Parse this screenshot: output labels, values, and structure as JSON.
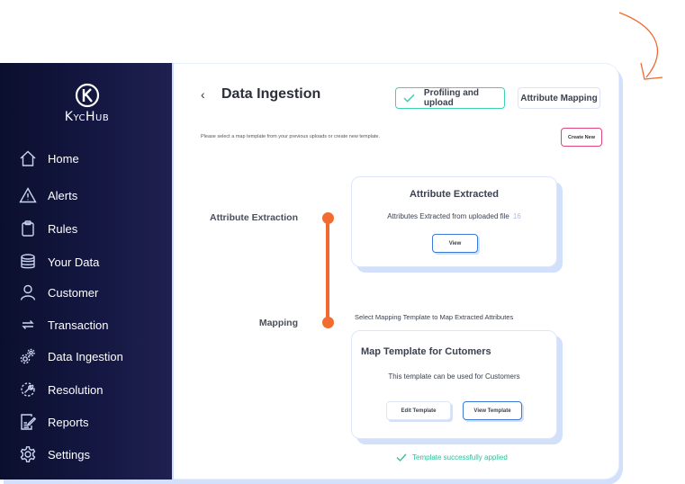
{
  "brand": {
    "name": "KycHub",
    "logo_icon": "k-circle-logo-icon"
  },
  "sidebar": {
    "items": [
      {
        "label": "Home",
        "icon": "home-icon"
      },
      {
        "label": "Alerts",
        "icon": "alert-triangle-icon"
      },
      {
        "label": "Rules",
        "icon": "clipboard-icon"
      },
      {
        "label": "Your Data",
        "icon": "database-icon"
      },
      {
        "label": "Customer",
        "icon": "user-icon"
      },
      {
        "label": "Transaction",
        "icon": "transfer-arrows-icon"
      },
      {
        "label": "Data Ingestion",
        "icon": "gears-icon"
      },
      {
        "label": "Resolution",
        "icon": "gear-wrench-icon"
      },
      {
        "label": "Reports",
        "icon": "report-edit-icon"
      },
      {
        "label": "Settings",
        "icon": "settings-gear-icon"
      }
    ]
  },
  "header": {
    "back_label": "‹",
    "title": "Data Ingestion",
    "steps": [
      {
        "label": "Profiling and upload",
        "status": "completed"
      },
      {
        "label": "Attribute Mapping",
        "status": "pending"
      }
    ]
  },
  "helper_text": "Please select a map template from your previous uploads or create new template.",
  "create_new_label": "Create New",
  "timeline": {
    "steps": [
      {
        "label": "Attribute Extraction"
      },
      {
        "label": "Mapping"
      }
    ],
    "color": "#f26b30"
  },
  "extraction_card": {
    "title": "Attribute Extracted",
    "text": "Attributes Extracted from uploaded file",
    "count": "16",
    "view_label": "View"
  },
  "mapping": {
    "instruction": "Select Mapping Template to Map Extracted Attributes",
    "card": {
      "title": "Map Template for Cutomers",
      "text": "This template can be used for Customers",
      "edit_label": "Edit Template",
      "view_label": "View Template"
    },
    "success_message": "Template successfully applied"
  },
  "colors": {
    "sidebar_bg": "#141741",
    "accent_teal": "#3dd2b0",
    "accent_pink": "#e0457b",
    "accent_orange": "#f26b30",
    "accent_blue": "#3c78d8",
    "shadow_blue": "#d3e0fb"
  }
}
